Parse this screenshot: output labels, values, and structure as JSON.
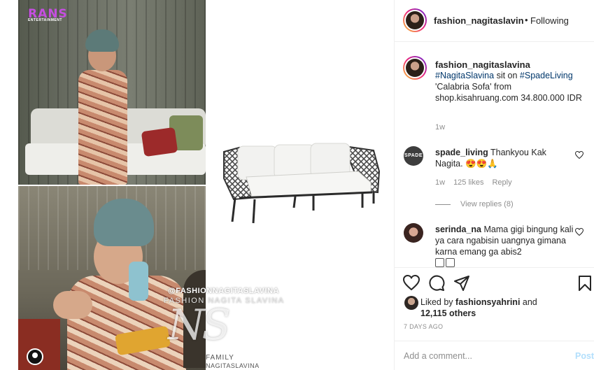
{
  "media": {
    "logo": "RANS",
    "logo_sub": "ENTERTAINMENT",
    "watermark_handle": "@FASHIONNAGITASLAVINA",
    "watermark_name": "FASHION NAGITA SLAVINA",
    "watermark_monogram": "NS",
    "watermark_family": "FAMILY",
    "watermark_family2": "NAGITASLAVINA"
  },
  "header": {
    "username": "fashion_nagitaslavina",
    "separator": "•",
    "follow_status": "Following"
  },
  "caption": {
    "username": "fashion_nagitaslavina",
    "tag1": "#NagitaSlavina",
    "text1": " sit on ",
    "tag2": "#SpadeLiving",
    "text2": " 'Calabria Sofa' from shop.kisahruang.com 34.800.000 IDR",
    "time": "1w"
  },
  "comments": [
    {
      "avatar_text": "SPADE",
      "username": "spade_living",
      "text": "Thankyou Kak Nagita. 😍😍🙏",
      "time": "1w",
      "likes": "125 likes",
      "reply": "Reply",
      "view_replies": "View replies (8)"
    },
    {
      "username": "serinda_na",
      "text": "Mama gigi bingung kali ya cara ngabisin uangnya gimana karna emang ga abis2"
    }
  ],
  "actions": {
    "liked_by_prefix": "Liked by ",
    "liked_by_user": "fashionsyahrini",
    "liked_by_and": " and",
    "others": "12,115 others",
    "date": "7 DAYS AGO"
  },
  "add_comment": {
    "placeholder": "Add a comment...",
    "post_label": "Post"
  },
  "colors": {
    "link": "#00376b",
    "meta": "#8e8e8e",
    "post_disabled": "#b2dffc",
    "border": "#efefef"
  }
}
